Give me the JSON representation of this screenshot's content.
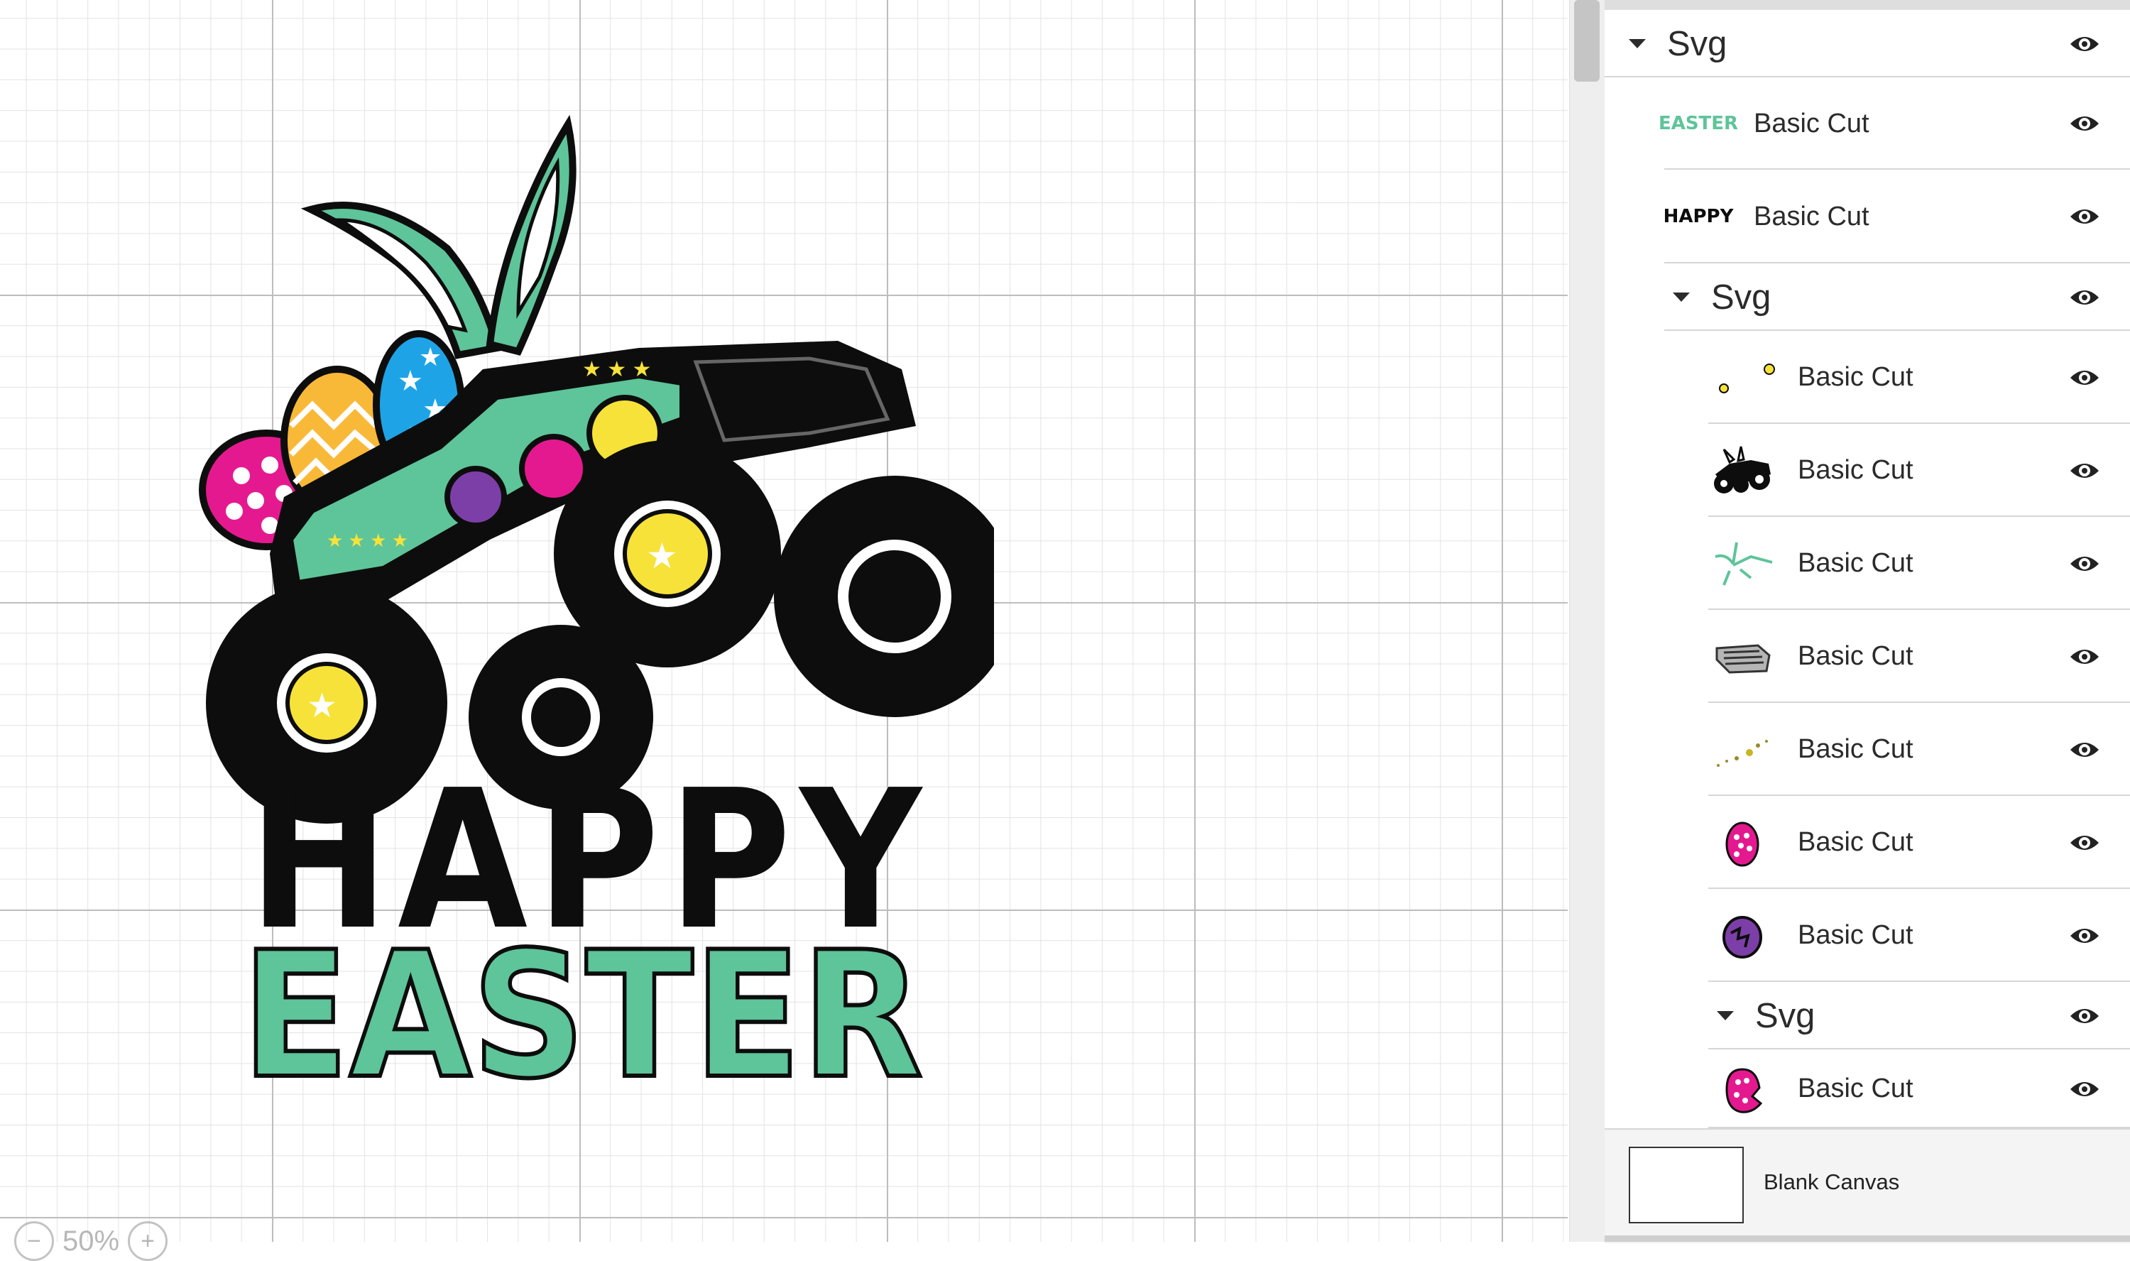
{
  "canvas": {
    "grid_minor_color": "#e3e3e3",
    "grid_major_color": "#bdbdbd",
    "artwork": {
      "line1": "HAPPY",
      "line2": "EASTER",
      "colors": {
        "black": "#0d0d0d",
        "green": "#5ec49a",
        "pink": "#e5198f",
        "yellow": "#f7e23a",
        "orange": "#f9b938",
        "blue": "#1ea4e6",
        "purple": "#7c3fa8"
      }
    }
  },
  "zoom": {
    "label": "50%",
    "minus_icon": "zoom-out-icon",
    "plus_icon": "zoom-in-icon"
  },
  "layers_panel": {
    "root_group": {
      "label": "Svg",
      "icon": "eye-icon"
    },
    "items": [
      {
        "label": "Basic Cut",
        "thumb_text": "EASTER",
        "thumb_color": "#5ec49a"
      },
      {
        "label": "Basic Cut",
        "thumb_text": "HAPPY",
        "thumb_color": "#0d0d0d"
      }
    ],
    "nested_group": {
      "label": "Svg",
      "items": [
        {
          "label": "Basic Cut",
          "thumb": "yellow-dots"
        },
        {
          "label": "Basic Cut",
          "thumb": "monster-truck"
        },
        {
          "label": "Basic Cut",
          "thumb": "green-outline"
        },
        {
          "label": "Basic Cut",
          "thumb": "grey-grille"
        },
        {
          "label": "Basic Cut",
          "thumb": "gold-specks"
        },
        {
          "label": "Basic Cut",
          "thumb": "pink-egg"
        },
        {
          "label": "Basic Cut",
          "thumb": "purple-egg"
        }
      ],
      "sub_group": {
        "label": "Svg",
        "items": [
          {
            "label": "Basic Cut",
            "thumb": "pink-egg-broken"
          }
        ]
      }
    },
    "blank_canvas": {
      "label": "Blank Canvas"
    }
  }
}
